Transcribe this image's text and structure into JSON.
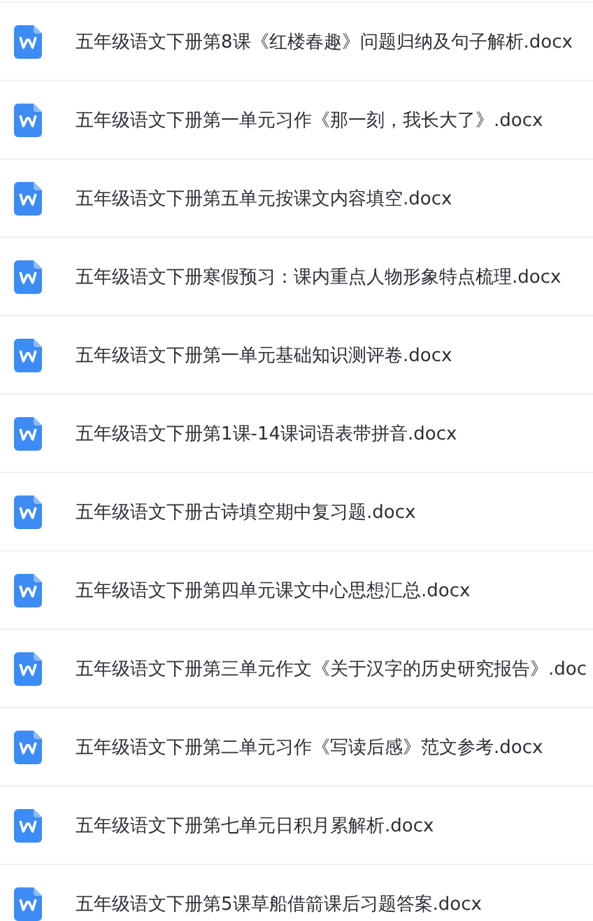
{
  "files": [
    {
      "name": "五年级语文下册第8课《红楼春趣》问题归纳及句子解析.docx"
    },
    {
      "name": "五年级语文下册第一单元习作《那一刻，我长大了》.docx"
    },
    {
      "name": "五年级语文下册第五单元按课文内容填空.docx"
    },
    {
      "name": "五年级语文下册寒假预习：课内重点人物形象特点梳理.docx"
    },
    {
      "name": "五年级语文下册第一单元基础知识测评卷.docx"
    },
    {
      "name": "五年级语文下册第1课-14课词语表带拼音.docx"
    },
    {
      "name": "五年级语文下册古诗填空期中复习题.docx"
    },
    {
      "name": "五年级语文下册第四单元课文中心思想汇总.docx"
    },
    {
      "name": "五年级语文下册第三单元作文《关于汉字的历史研究报告》.doc"
    },
    {
      "name": "五年级语文下册第二单元习作《写读后感》范文参考.docx"
    },
    {
      "name": "五年级语文下册第七单元日积月累解析.docx"
    },
    {
      "name": "五年级语文下册第5课草船借箭课后习题答案.docx"
    }
  ]
}
